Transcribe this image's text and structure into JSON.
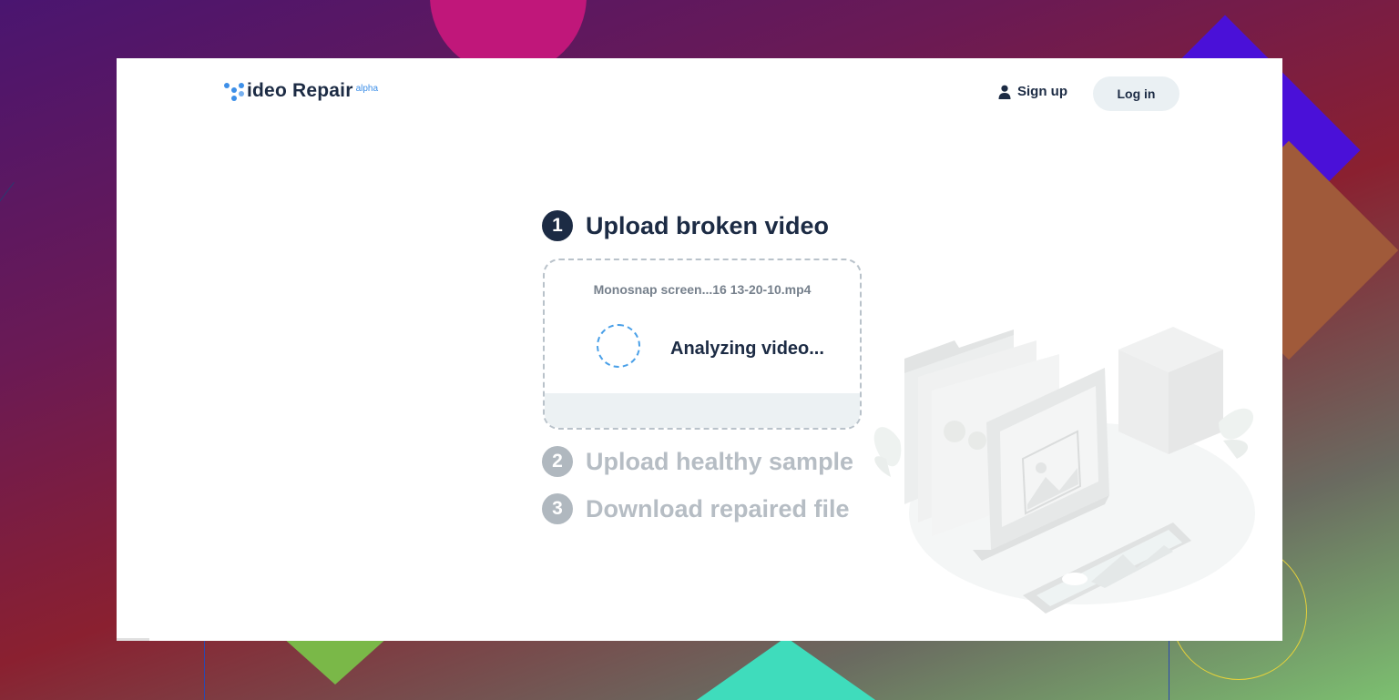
{
  "app": {
    "logo_text": "ideo Repair",
    "logo_badge": "alpha"
  },
  "header": {
    "signup_label": "Sign up",
    "login_label": "Log in"
  },
  "steps": [
    {
      "number": "1",
      "label": "Upload broken video",
      "state": "active"
    },
    {
      "number": "2",
      "label": "Upload healthy sample",
      "state": "inactive"
    },
    {
      "number": "3",
      "label": "Download repaired file",
      "state": "inactive"
    }
  ],
  "upload": {
    "filename": "Monosnap screen...16 13-20-10.mp4",
    "status": "Analyzing video..."
  },
  "colors": {
    "primary_text": "#1c2b44",
    "accent": "#3d8fe8",
    "muted": "#b6bdc4",
    "button_bg": "#eaf0f3"
  },
  "icons": {
    "logo": "video-repair-logo-icon",
    "user": "user-icon",
    "spinner": "loading-spinner-icon",
    "illustration": "files-laptop-illustration"
  }
}
